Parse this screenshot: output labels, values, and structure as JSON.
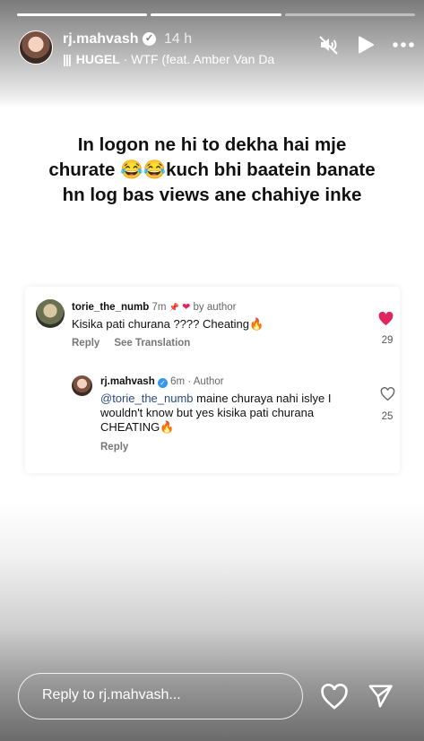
{
  "story": {
    "segments": [
      {
        "done": true
      },
      {
        "done": true
      },
      {
        "done": false
      }
    ]
  },
  "header": {
    "username": "rj.mahvash",
    "time": "14 h",
    "music_bars": "|||",
    "music_artist": "HUGEL",
    "music_title": "· WTF (feat. Amber Van Da",
    "icons": [
      "mute-icon",
      "play-icon",
      "more-icon"
    ]
  },
  "post": {
    "headline_line1": "In logon ne hi to dekha hai mje",
    "headline_line2": "churate 😂😂kuch bhi baatein banate",
    "headline_line3": "hn log bas views ane chahiye inke"
  },
  "comments": {
    "first": {
      "username": "torie_the_numb",
      "time": "7m",
      "pin": "📌",
      "heart": "❤",
      "liked_by": "by author",
      "text": "Kisika pati churana ???? Cheating🔥",
      "reply_label": "Reply",
      "translate_label": "See Translation",
      "likes": "29",
      "liked": true
    },
    "reply": {
      "username": "rj.mahvash",
      "time": "6m",
      "author_tag": "· Author",
      "mention": "@torie_the_numb",
      "text": " maine churaya nahi islye I wouldn't know but yes kisika pati churana CHEATING🔥",
      "reply_label": "Reply",
      "likes": "25",
      "liked": false
    }
  },
  "footer": {
    "reply_placeholder": "Reply to rj.mahvash...",
    "icons": [
      "heart-icon",
      "send-icon"
    ]
  },
  "colors": {
    "like_red": "#e0245e",
    "verified_blue": "#3897f0",
    "mention_blue": "#2a4a7f"
  }
}
